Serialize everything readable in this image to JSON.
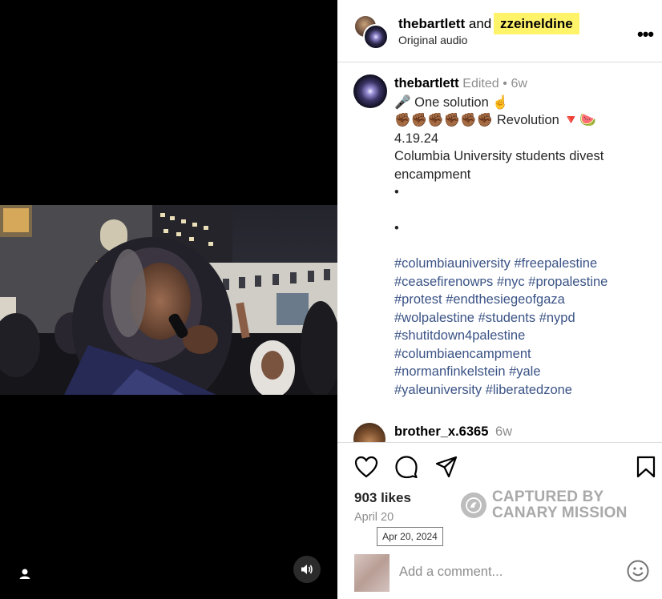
{
  "header": {
    "user1": "thebartlett",
    "conjunction": "and",
    "user2": "zzeineldine",
    "subtitle": "Original audio",
    "more_label": "•••"
  },
  "caption": {
    "username": "thebartlett",
    "edited": "Edited",
    "separator": "•",
    "time": "6w",
    "line1": "🎤 One solution ☝️",
    "line2": "✊🏾✊🏾✊🏾✊🏾✊🏾✊🏾 Revolution 🔻🍉",
    "line3": "4.19.24",
    "line4": "Columbia University students divest encampment",
    "dot1": "•",
    "dot2": "•",
    "hashtags": [
      "#columbiauniversity #freepalestine",
      "#ceasefirenowᴘs #nyc #propalestine",
      "#protest #endthesiegeofgaza",
      "#wolpalestine #students #nypd",
      "#shutitdown4palestine",
      "#columbiaencampment",
      "#normanfinkelstein #yale",
      "#yaleuniversity #liberatedzone"
    ]
  },
  "comment": {
    "username": "brother_x.6365",
    "time": "6w"
  },
  "stats": {
    "likes": "903 likes",
    "date": "April 20",
    "tooltip": "Apr 20, 2024"
  },
  "watermark": {
    "line1": "CAPTURED BY",
    "line2": "CANARY MISSION"
  },
  "comment_box": {
    "placeholder": "Add a comment..."
  },
  "icons": {
    "like": "heart-icon",
    "comment": "comment-icon",
    "share": "share-icon",
    "save": "bookmark-icon",
    "emoji": "emoji-icon",
    "audio": "speaker-icon",
    "tag": "user-tag-icon"
  },
  "colors": {
    "highlight": "#fff36a",
    "hashtag": "#3b5386",
    "meta": "#8e8e8e"
  }
}
